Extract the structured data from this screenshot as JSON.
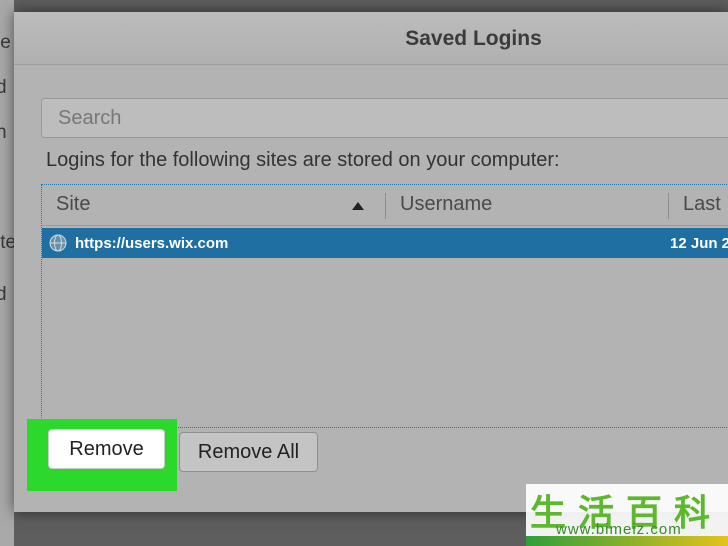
{
  "background": {
    "fragments": [
      "le",
      "d",
      "n",
      "ite",
      "d"
    ]
  },
  "dialog": {
    "title": "Saved Logins",
    "search": {
      "placeholder": "Search",
      "value": ""
    },
    "description": "Logins for the following sites are stored on your computer:",
    "table": {
      "columns": [
        "Site",
        "Username",
        "Last"
      ],
      "sort_column": "Site",
      "sort_direction": "ascending",
      "rows": [
        {
          "site": "https://users.wix.com",
          "username": "",
          "last": "12 Jun 2",
          "selected": true
        }
      ]
    },
    "buttons": {
      "remove": "Remove",
      "remove_all": "Remove All"
    }
  },
  "watermark": {
    "characters": "生活百科",
    "url": "www.bimeiz.com"
  },
  "colors": {
    "selection": "#1f6fa3",
    "highlight": "#2bd82b",
    "dialog_bg": "#b3b3b3"
  },
  "icons": {
    "sort": "sort-ascending-icon",
    "site": "globe-icon"
  }
}
